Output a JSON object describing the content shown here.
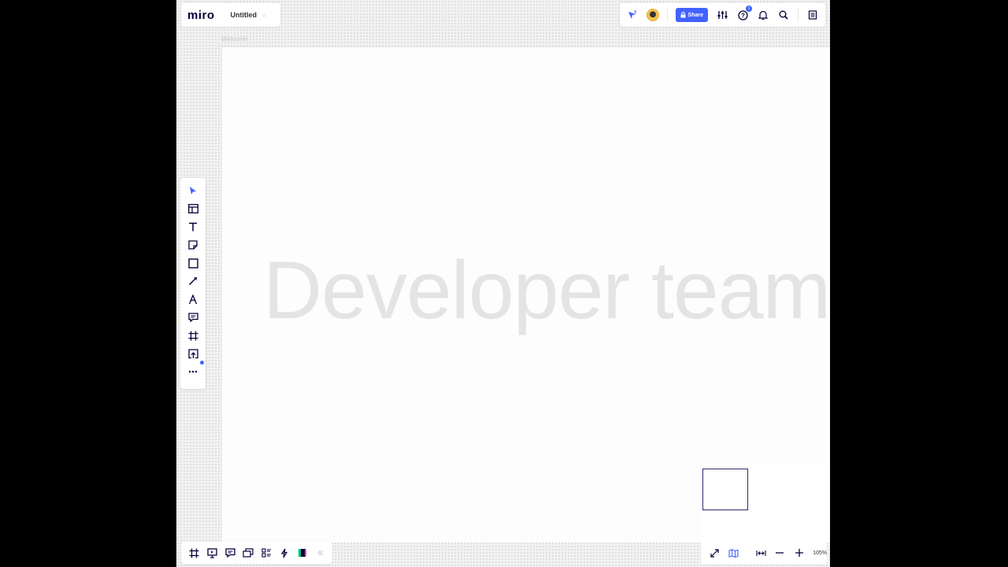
{
  "app": {
    "logo": "miro",
    "board_title": "Untitled"
  },
  "header": {
    "share_label": "Share",
    "notification_count": "1"
  },
  "frame": {
    "label": "Welcome",
    "big_text": "Developer team"
  },
  "left_toolbar": {
    "tools": [
      "select",
      "templates",
      "text",
      "sticky-note",
      "shape",
      "pen-line",
      "pen",
      "comment",
      "frame",
      "upload",
      "more"
    ]
  },
  "bottom_toolbar": {
    "tools": [
      "frames",
      "presentation",
      "comments",
      "cards",
      "kanban",
      "activity",
      "apps",
      "collapse"
    ]
  },
  "zoom": {
    "level": "105%"
  },
  "colors": {
    "accent": "#4262ff",
    "ink": "#050038"
  }
}
